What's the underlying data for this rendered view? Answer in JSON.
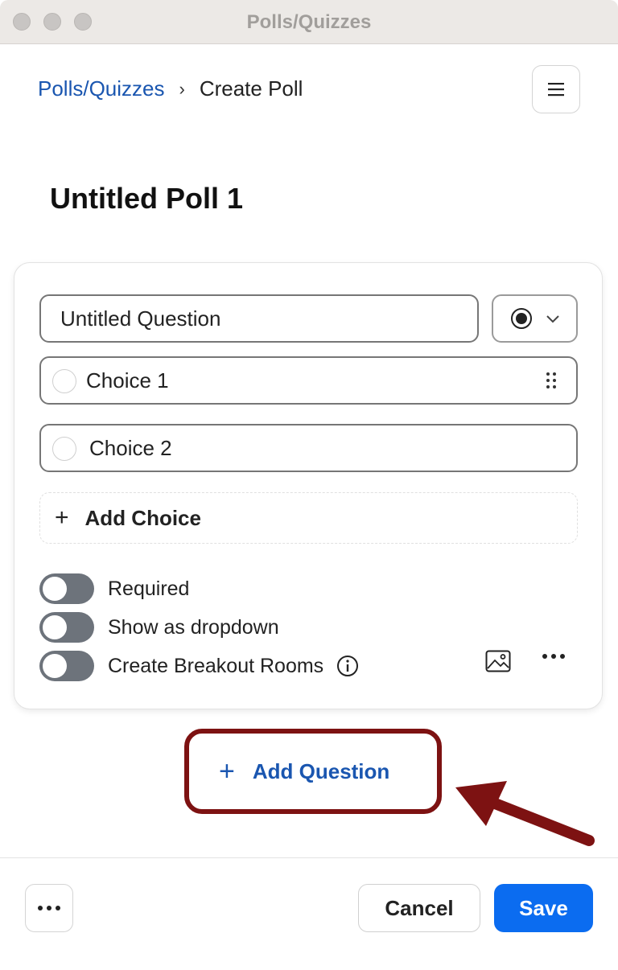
{
  "window": {
    "title": "Polls/Quizzes"
  },
  "breadcrumb": {
    "parent": "Polls/Quizzes",
    "separator": "›",
    "current": "Create Poll"
  },
  "poll": {
    "title": "Untitled Poll 1"
  },
  "question": {
    "title": "Untitled Question",
    "type_icon": "radio-selected-icon",
    "choices": [
      {
        "label": "Choice 1"
      },
      {
        "label": "Choice 2"
      }
    ],
    "add_choice_label": "Add Choice",
    "options": [
      {
        "label": "Required",
        "enabled": false
      },
      {
        "label": "Show as dropdown",
        "enabled": false
      },
      {
        "label": "Create Breakout Rooms",
        "enabled": false
      }
    ]
  },
  "actions": {
    "add_question_label": "Add Question",
    "cancel_label": "Cancel",
    "save_label": "Save"
  },
  "colors": {
    "accent": "#0b6cf0",
    "link": "#1a56b0",
    "toggle_off": "#6d737b",
    "annotation": "#7d1212"
  }
}
